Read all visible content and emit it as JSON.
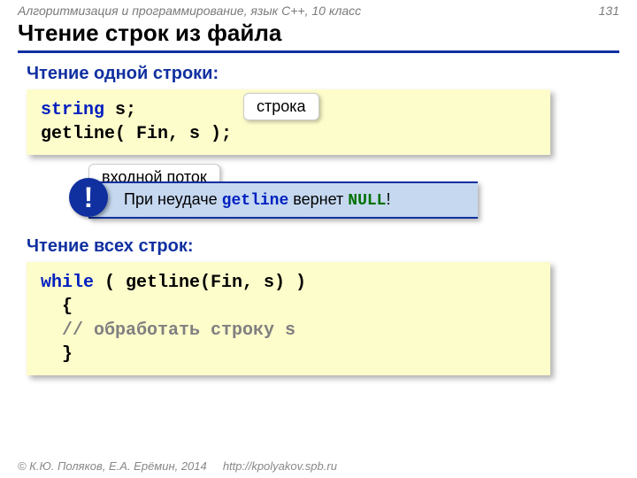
{
  "header": {
    "course": "Алгоритмизация и программирование, язык С++, 10 класс",
    "page": "131"
  },
  "title": "Чтение строк из файла",
  "section1": {
    "heading": "Чтение одной строки:",
    "code": {
      "kw1": "string",
      "rest1": " s;",
      "line2a": "getline( Fin, s );"
    },
    "callout_str": "строка",
    "callout_stream": "входной поток"
  },
  "note": {
    "excl": "!",
    "t1": "При неудаче ",
    "mono": "getline",
    "t2": " вернет ",
    "null": "NULL",
    "t3": "!"
  },
  "section2": {
    "heading": "Чтение всех строк:",
    "code": {
      "kw": "while",
      "after": " ( getline(Fin, s) )",
      "brace_open": "  {",
      "comment": "  // обработать строку s",
      "brace_close": "  }"
    }
  },
  "footer": {
    "copyright": "© К.Ю. Поляков, Е.А. Ерёмин, 2014",
    "url": "http://kpolyakov.spb.ru"
  }
}
